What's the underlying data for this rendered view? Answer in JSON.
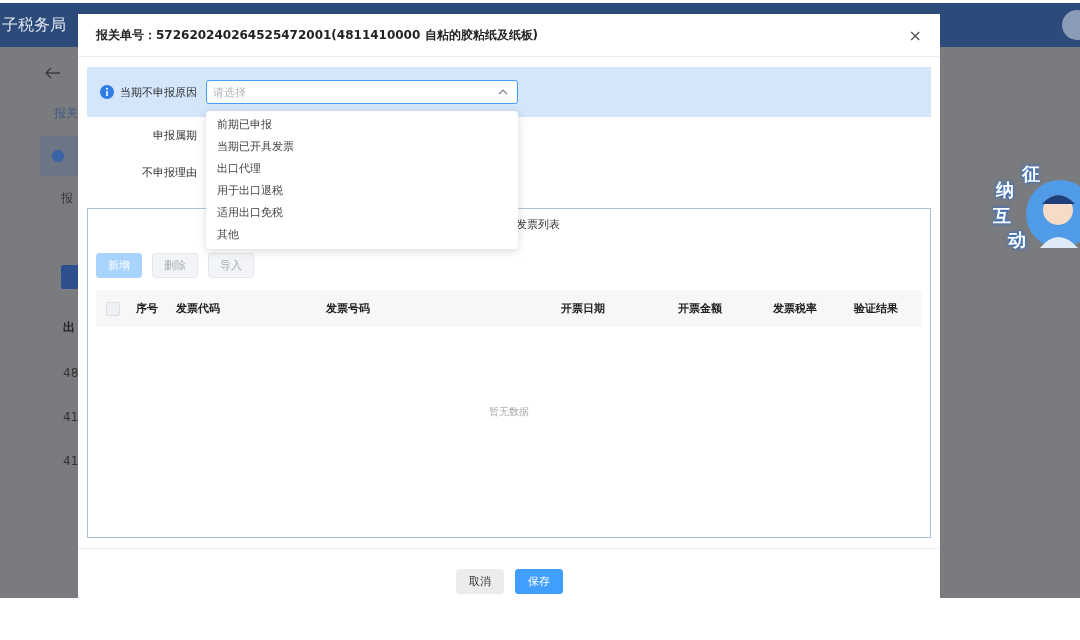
{
  "header": {
    "title": "子税务局"
  },
  "background_page": {
    "tab": "报关",
    "field_label": "报",
    "column_header": "出",
    "rows": [
      "48",
      "41",
      "41"
    ]
  },
  "dialog": {
    "title": "报关单号：572620240264525472001(4811410000 自粘的胶粘纸及纸板)",
    "close": "×",
    "reason": {
      "label": "当期不申报原因",
      "placeholder": "请选择",
      "expanded": true,
      "options": [
        {
          "label": "前期已申报",
          "selected": false
        },
        {
          "label": "当期已开具发票",
          "selected": false
        },
        {
          "label": "出口代理",
          "selected": false
        },
        {
          "label": "用于出口退税",
          "selected": false
        },
        {
          "label": "适用出口免税",
          "selected": false
        },
        {
          "label": "其他",
          "selected": false
        }
      ]
    },
    "form_labels": [
      "申报属期",
      "不申报理由"
    ],
    "invoice_panel": {
      "title": "发票列表",
      "buttons": [
        {
          "label": "新增",
          "kind": "primary",
          "disabled": true
        },
        {
          "label": "删除",
          "kind": "default",
          "disabled": true
        },
        {
          "label": "导入",
          "kind": "default",
          "disabled": true
        }
      ],
      "select_all": {
        "checked": false
      },
      "columns": [
        "序号",
        "发票代码",
        "发票号码",
        "开票日期",
        "开票金额",
        "发票税率",
        "验证结果"
      ],
      "empty_text": "暂无数据"
    },
    "footer_buttons": [
      {
        "label": "取消",
        "kind": "default",
        "disabled": false
      },
      {
        "label": "保存",
        "kind": "primary",
        "disabled": false
      }
    ]
  },
  "assistant_badge": {
    "characters": [
      "征",
      "纳",
      "互",
      "动"
    ]
  }
}
